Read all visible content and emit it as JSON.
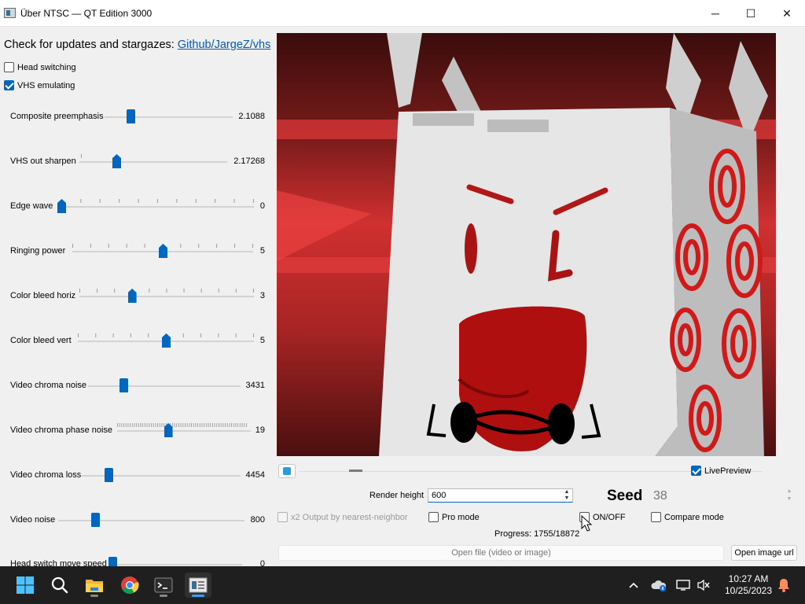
{
  "window": {
    "title": "Über NTSC — QT Edition 3000",
    "minimize_glyph": "─",
    "maximize_glyph": "☐",
    "close_glyph": "✕"
  },
  "sidebar": {
    "updates_text": "Check for updates and stargazes: ",
    "updates_link": "Github/JargeZ/vhs",
    "checkboxes": [
      {
        "label": "Head switching",
        "checked": false
      },
      {
        "label": "VHS emulating",
        "checked": true
      }
    ],
    "sliders": [
      {
        "label": "Composite preemphasis",
        "value": "2.1088",
        "fraction": 0.2
      },
      {
        "label": "VHS out sharpen",
        "value": "2.17268",
        "fraction": 0.25
      },
      {
        "label": "Edge wave",
        "value": "0",
        "fraction": 0.0
      },
      {
        "label": "Ringing power",
        "value": "5",
        "fraction": 0.5
      },
      {
        "label": "Color bleed horiz",
        "value": "3",
        "fraction": 0.3
      },
      {
        "label": "Color bleed vert",
        "value": "5",
        "fraction": 0.5
      },
      {
        "label": "Video chroma noise",
        "value": "3431",
        "fraction": 0.23
      },
      {
        "label": "Video chroma phase noise",
        "value": "19",
        "fraction": 0.38
      },
      {
        "label": "Video chroma loss",
        "value": "4454",
        "fraction": 0.17
      },
      {
        "label": "Video noise",
        "value": "800",
        "fraction": 0.2
      },
      {
        "label": "Head switch move speed",
        "value": "0",
        "fraction": 0.0
      }
    ]
  },
  "controls": {
    "live_preview_label": "LivePreview",
    "live_preview_checked": true,
    "render_height_label": "Render height",
    "render_height_value": "600",
    "seed_label": "Seed",
    "seed_value": "38",
    "x2_label": "x2 Output by nearest-neighbor",
    "pro_mode_label": "Pro mode",
    "onoff_label": "ON/OFF",
    "compare_label": "Compare mode",
    "progress_text": "Progress: 1755/18872",
    "open_file_label": "Open file (video or image)",
    "open_url_label": "Open image url"
  },
  "taskbar": {
    "time": "10:27 AM",
    "date": "10/25/2023",
    "icons": [
      "start-icon",
      "search-icon",
      "file-explorer-icon",
      "chrome-icon",
      "terminal-icon",
      "uber-ntsc-app-icon"
    ],
    "tray_icons": [
      "chevron-up-icon",
      "onedrive-icon",
      "display-icon",
      "volume-muted-icon",
      "notification-bell-icon"
    ]
  },
  "colors": {
    "accent": "#0067c0",
    "link": "#0b57b0",
    "taskbar_bg": "#1f1f1f"
  }
}
